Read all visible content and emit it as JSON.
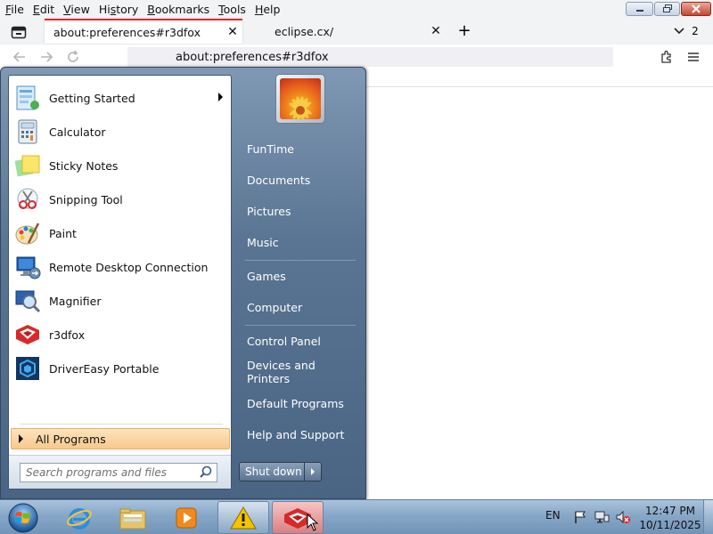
{
  "menubar": {
    "items": [
      "File",
      "Edit",
      "View",
      "History",
      "Bookmarks",
      "Tools",
      "Help"
    ],
    "access_keys": [
      "F",
      "E",
      "V",
      "s",
      "B",
      "T",
      "H"
    ]
  },
  "tabs": [
    {
      "title": "about:preferences#r3dfox",
      "active": true
    },
    {
      "title": "eclipse.cx/",
      "active": false
    }
  ],
  "tab_count": "2",
  "urlbar": {
    "value": "about:preferences#r3dfox"
  },
  "start_menu": {
    "programs": [
      {
        "label": "Getting Started",
        "icon": "getting-started-icon",
        "has_submenu": true
      },
      {
        "label": "Calculator",
        "icon": "calculator-icon"
      },
      {
        "label": "Sticky Notes",
        "icon": "sticky-notes-icon"
      },
      {
        "label": "Snipping Tool",
        "icon": "snipping-tool-icon"
      },
      {
        "label": "Paint",
        "icon": "paint-icon"
      },
      {
        "label": "Remote Desktop Connection",
        "icon": "remote-desktop-icon"
      },
      {
        "label": "Magnifier",
        "icon": "magnifier-icon"
      },
      {
        "label": "r3dfox",
        "icon": "r3dfox-icon"
      },
      {
        "label": "DriverEasy Portable",
        "icon": "drivereasy-icon"
      }
    ],
    "all_programs": "All Programs",
    "search_placeholder": "Search programs and files",
    "right_items": [
      "FunTime",
      "Documents",
      "Pictures",
      "Music",
      "Games",
      "Computer",
      "Control Panel",
      "Devices and Printers",
      "Default Programs",
      "Help and Support"
    ],
    "shutdown": "Shut down"
  },
  "taskbar": {
    "language": "EN",
    "time": "12:47 PM",
    "date": "10/11/2025"
  },
  "colors": {
    "active_tab_accent": "#e0272f",
    "start_menu_bg": "#5a7593",
    "taskbar_bg": "#86a7c7",
    "all_programs_highlight": "#f7c98c"
  }
}
